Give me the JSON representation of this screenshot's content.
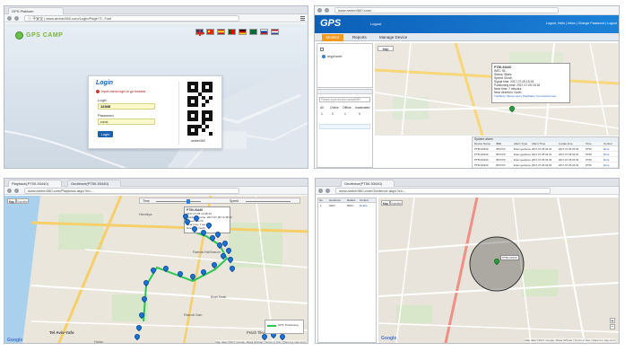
{
  "shot1": {
    "tab_title": "GPS Platform",
    "address": "Ⓘ 不安全 | www.amber360.com/Login/Page?T...Fuel",
    "brand": "GPS CAMP",
    "login": {
      "title": "Login",
      "warning": "Input check login to go forward.",
      "login_label": "Login",
      "login_value": "12345",
      "password_label": "Password",
      "password_value": "••••••",
      "button": "Login",
      "qr_caption": "amber360"
    }
  },
  "shot2": {
    "address": "www.amber360.com/...",
    "logo": "GPS",
    "header_link": "Logout",
    "header_right": "Logout, Hello | Inbox | Change Password | Logout",
    "tabs": [
      "Monitor",
      "Reports",
      "Manage Device"
    ],
    "device_item": "myphone",
    "search_placeholder": "Please input device name/IMEI",
    "status_cols": [
      "All",
      "Online",
      "Offline",
      "Inactivated"
    ],
    "status_vals": [
      "1",
      "0",
      "1",
      "0"
    ],
    "street_label": "Petah Tikva",
    "popup_lines": [
      "PT50-93440",
      "IMEI: 35...",
      "Status: Static",
      "Speed: 0km/h",
      "Signal time: 2017-07-05 15:15",
      "Positioning time: 2017-07-05 15:16",
      "Near time: 7 minutes",
      "Near direction: North",
      "Tracking | Street view | Playback | Command more"
    ],
    "table_title": "System alarm",
    "table_headers": [
      "Device Name",
      "IMEI",
      "Alarm Type",
      "Alarm Time",
      "Locate time",
      "Time",
      "Control"
    ],
    "table_rows": [
      [
        "PT50-93440",
        "35XXXX",
        "Enter geofence",
        "2017-07-05 04:33",
        "2017-07-05 04:33",
        "PT50",
        "More"
      ],
      [
        "PT50-93440",
        "35XXXX",
        "Enter geofence",
        "2017-07-05 04:33",
        "2017-07-05 04:33",
        "PT50",
        "More"
      ],
      [
        "PT50-93440",
        "35XXXX",
        "Enter geofence",
        "2017-07-05 04:33",
        "2017-07-05 04:33",
        "PT50",
        "More"
      ],
      [
        "PT50-93440",
        "35XXXX",
        "Enter geofence",
        "2017-07-05 04:33",
        "2017-07-05 04:33",
        "PT50",
        "More"
      ]
    ]
  },
  "shot3": {
    "tabs": [
      "Playback(PT50-93440)",
      "Geofence(PT50-93440)"
    ],
    "address": "www.amber360.com/Playback.aspx?id=...",
    "map_tabs": [
      "Map",
      "Satellite"
    ],
    "time_label": "Time",
    "speed_label": "Speed",
    "popup_lines": [
      "PT50-93440",
      "2017-07-05 14:35:43",
      "Positioning time: 2017-07-05 14:35:43",
      "Speed: 0km/h",
      "Near time: 1 second",
      "Direction: North"
    ],
    "cities": [
      "Herzliya",
      "Ramat HaSharon",
      "Tel Aviv-Yafo",
      "Petah Tikva",
      "Ramat Gan",
      "Bnei Brak",
      "Holon"
    ],
    "footer": "Map data ©2017 Google, Mapa GISrael | Terms of Use | Report a map error",
    "legend": "GPS: Positioning"
  },
  "shot4": {
    "tab_title": "Geofence(PT50-93440)",
    "address": "www.amber360.com/Geofence.aspx?id=...",
    "table_headers": [
      "No.",
      "Geofence",
      "Radius",
      "Control"
    ],
    "table_row": [
      "1",
      "GEO",
      "500m",
      "Delete"
    ],
    "map_tabs": [
      "Map",
      "Satellite"
    ],
    "fence_label": "PT50-93440",
    "footer": "Map data ©2017 Google, Mapa GISrael | Terms of Use | Report a map error"
  }
}
